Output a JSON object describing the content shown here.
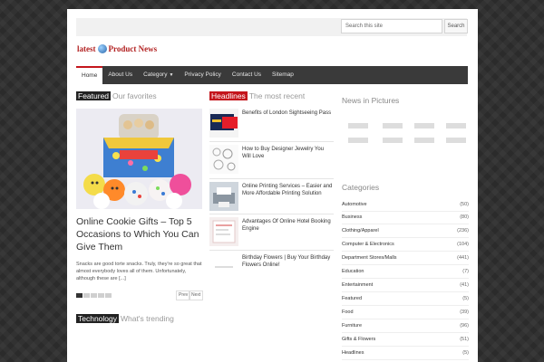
{
  "search": {
    "placeholder": "Search this site",
    "button_label": "Search"
  },
  "logo": {
    "text_left": "latest",
    "text_right": "Product News"
  },
  "nav": {
    "items": [
      {
        "label": "Home",
        "active": true
      },
      {
        "label": "About Us"
      },
      {
        "label": "Category",
        "has_caret": true
      },
      {
        "label": "Privacy Policy"
      },
      {
        "label": "Contact Us"
      },
      {
        "label": "Sitemap"
      }
    ]
  },
  "featured": {
    "badge": "Featured",
    "subtitle": "Our favorites",
    "title": "Online Cookie Gifts – Top 5 Occasions to Which You Can Give Them",
    "excerpt": "Snacks are good torte snacks. Truly, they're so great that almost everybody loves all of them. Unfortunately, although these are [...]",
    "prev_label": "Prev",
    "next_label": "Next",
    "slides": 5,
    "active_slide": 1
  },
  "headlines": {
    "badge": "Headlines",
    "subtitle": "The most recent",
    "items": [
      {
        "title": "Benefits of London Sightseeing Pass",
        "thumb_icon": "london-pass-thumbnail"
      },
      {
        "title": "How to Buy Designer Jewelry You Will Love",
        "thumb_icon": "jewelry-thumbnail"
      },
      {
        "title": "Online Printing Services – Easier and More Affordable Printing Solution",
        "thumb_icon": "printing-thumbnail"
      },
      {
        "title": "Advantages Of Online Hotel Booking Engine",
        "thumb_icon": "hotel-booking-thumbnail"
      },
      {
        "title": "Birthday Flowers | Buy Your Birthday Flowers Online!",
        "thumb_icon": "flowers-thumbnail"
      }
    ]
  },
  "technology": {
    "badge": "Technology",
    "subtitle": "What's trending"
  },
  "pictures": {
    "title": "News in Pictures"
  },
  "categories": {
    "title": "Categories",
    "items": [
      {
        "name": "Automotive",
        "count": "(50)"
      },
      {
        "name": "Business",
        "count": "(80)"
      },
      {
        "name": "Clothing/Apparel",
        "count": "(236)"
      },
      {
        "name": "Computer & Electronics",
        "count": "(104)"
      },
      {
        "name": "Department Stores/Malls",
        "count": "(441)"
      },
      {
        "name": "Education",
        "count": "(7)"
      },
      {
        "name": "Entertainment",
        "count": "(41)"
      },
      {
        "name": "Featured",
        "count": "(5)"
      },
      {
        "name": "Food",
        "count": "(39)"
      },
      {
        "name": "Furniture",
        "count": "(96)"
      },
      {
        "name": "Gifts & Flowers",
        "count": "(51)"
      },
      {
        "name": "Headlines",
        "count": "(5)"
      }
    ]
  },
  "colors": {
    "accent": "#c4151c",
    "nav_bg": "#3a3a3a",
    "page_bg": "#2b2b2b"
  }
}
